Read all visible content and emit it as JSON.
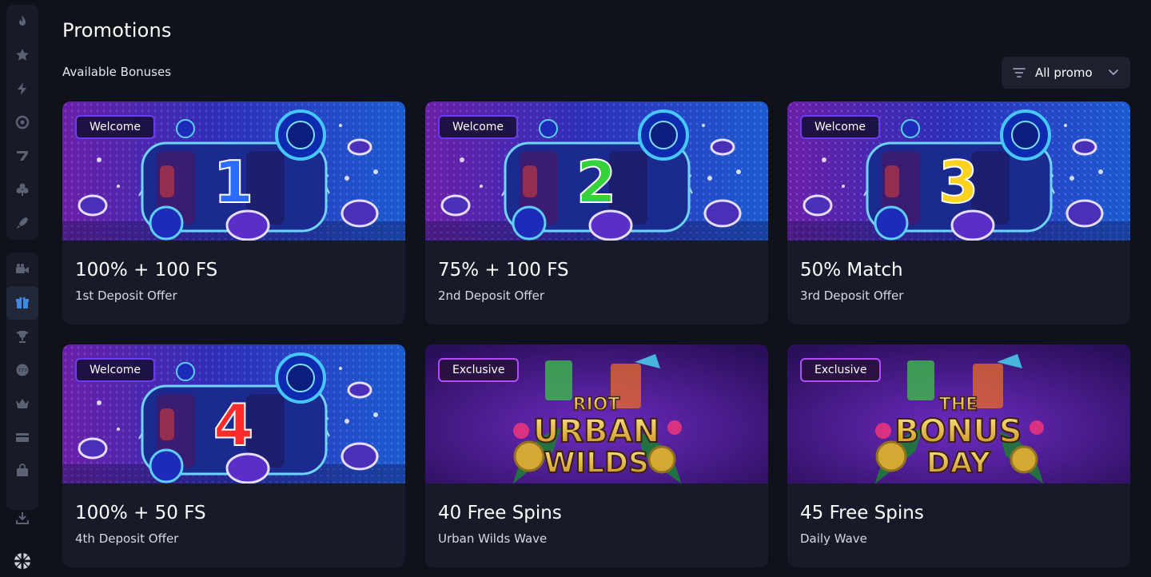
{
  "sidebar": {
    "group1": [
      "fire-icon",
      "star-icon",
      "lightning-icon",
      "target-icon",
      "slot-icon",
      "clubs-icon",
      "rocket-icon"
    ],
    "group2": [
      "camera-icon",
      "gift-icon",
      "trophy-icon",
      "lottery-icon",
      "crown-icon",
      "card-icon",
      "shop-icon"
    ],
    "download_icon": "download-icon",
    "language_icon": "uk-flag-icon"
  },
  "page": {
    "title": "Promotions",
    "subtitle": "Available Bonuses"
  },
  "filter": {
    "label": "All promo"
  },
  "cards": [
    {
      "badge": "Welcome",
      "title": "100% + 100 FS",
      "subtitle": "1st Deposit Offer",
      "number": "1",
      "color": "#2a6cff"
    },
    {
      "badge": "Welcome",
      "title": "75% + 100 FS",
      "subtitle": "2nd Deposit Offer",
      "number": "2",
      "color": "#35d23c"
    },
    {
      "badge": "Welcome",
      "title": "50% Match",
      "subtitle": "3rd Deposit Offer",
      "number": "3",
      "color": "#ffd21f"
    },
    {
      "badge": "Welcome",
      "title": "100% + 50 FS",
      "subtitle": "4th Deposit Offer",
      "number": "4",
      "color": "#ff2a2a"
    },
    {
      "badge": "Exclusive",
      "title": "40 Free Spins",
      "subtitle": "Urban Wilds Wave",
      "logo_top": "RIOT",
      "logo_main": "URBAN",
      "logo_bottom": "WILDS"
    },
    {
      "badge": "Exclusive",
      "title": "45 Free Spins",
      "subtitle": "Daily Wave",
      "logo_top": "THE",
      "logo_main": "BONUS",
      "logo_bottom": "DAY"
    }
  ]
}
